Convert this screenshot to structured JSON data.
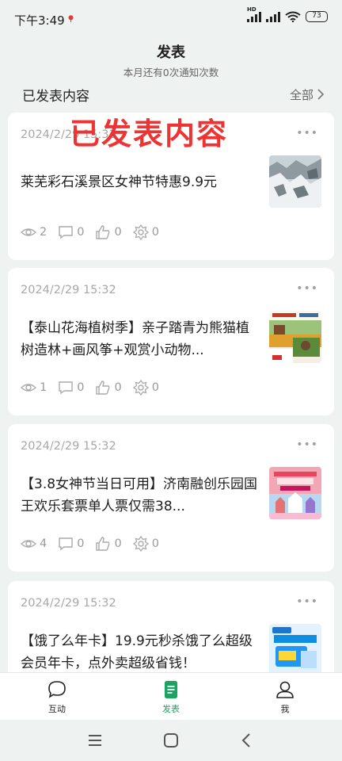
{
  "status": {
    "time": "下午3:49",
    "battery": "73",
    "network": "HD"
  },
  "header": {
    "title": "发表",
    "subtitle": "本月还有0次通知次数"
  },
  "section": {
    "title": "已发表内容",
    "link": "全部"
  },
  "watermark": "已发表内容",
  "cards": [
    {
      "date": "2024/2/29 15:32",
      "title": "莱芜彩石溪景区女神节特惠9.9元",
      "views": "2",
      "comments": "0",
      "likes": "0",
      "shares": "0",
      "thumb": "scenic-rocks-photo"
    },
    {
      "date": "2024/2/29 15:32",
      "title": "【泰山花海植树季】亲子踏青为熊猫植树造林+画风筝+观赏小动物...",
      "views": "1",
      "comments": "0",
      "likes": "0",
      "shares": "0",
      "thumb": "flower-field-photo"
    },
    {
      "date": "2024/2/29 15:32",
      "title": "【3.8女神节当日可用】济南融创乐园国王欢乐套票单人票仅需38...",
      "views": "4",
      "comments": "0",
      "likes": "0",
      "shares": "0",
      "thumb": "amusement-park-poster"
    },
    {
      "date": "2024/2/29 15:32",
      "title": "【饿了么年卡】19.9元秒杀饿了么超级会员年卡，点外卖超级省钱！",
      "views": "",
      "comments": "",
      "likes": "",
      "shares": "",
      "thumb": "membership-card-poster"
    }
  ],
  "tabs": [
    {
      "label": "互动",
      "icon": "chat-bubble-icon",
      "active": false
    },
    {
      "label": "发表",
      "icon": "document-icon",
      "active": true
    },
    {
      "label": "我",
      "icon": "person-icon",
      "active": false
    }
  ],
  "colors": {
    "accent": "#1aa361",
    "background": "#eef2f0",
    "watermark": "#e33333"
  }
}
